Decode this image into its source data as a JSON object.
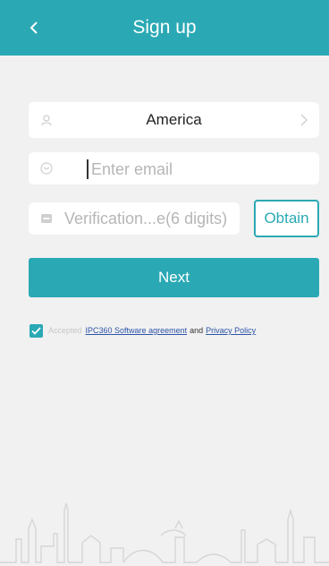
{
  "header": {
    "title": "Sign up"
  },
  "form": {
    "country": {
      "value": "America"
    },
    "email": {
      "placeholder": "Enter email"
    },
    "code": {
      "placeholder": "Verification...e(6 digits)"
    },
    "obtain_label": "Obtain",
    "next_label": "Next"
  },
  "agreement": {
    "checked": true,
    "prefix": "Accepted",
    "software_link": "IPC360 Software agreement",
    "conjunction": "and",
    "privacy_link": "Privacy Policy"
  },
  "icons": {
    "back": "chevron-left-icon",
    "country": "person-icon",
    "email": "envelope-icon",
    "code": "code-icon",
    "arrow": "chevron-right-icon",
    "check": "checkmark-icon",
    "skyline": "city-skyline"
  },
  "colors": {
    "accent": "#2aa9b4",
    "background": "#f1f1f1",
    "link": "#2d54a8"
  }
}
